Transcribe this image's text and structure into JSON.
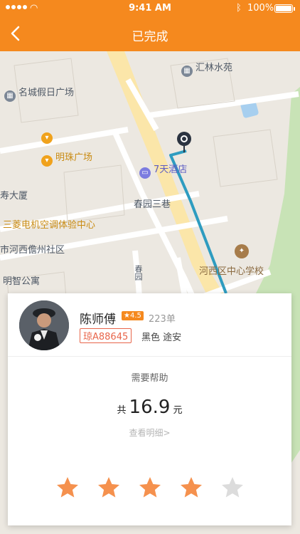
{
  "status_bar": {
    "time": "9:41 AM",
    "battery": "100%"
  },
  "nav": {
    "title": "已完成",
    "back_icon": "chevron-left-icon"
  },
  "map": {
    "pois": [
      {
        "label": "汇林水苑",
        "style": "gray",
        "icon": "building-icon"
      },
      {
        "label": "名城假日广场",
        "style": "gray",
        "icon": "building-icon"
      },
      {
        "label": "明珠广场",
        "style": "orange",
        "icon": "shopping-cart-icon"
      },
      {
        "label": "7天酒店",
        "style": "purple",
        "icon": "bed-icon"
      },
      {
        "label": "寿大厦",
        "style": "gray",
        "icon": ""
      },
      {
        "label": "春园三巷",
        "style": "gray",
        "icon": ""
      },
      {
        "label": "三菱电机空调体验中心",
        "style": "orange",
        "icon": ""
      },
      {
        "label": "市河西儋州社区",
        "style": "gray",
        "icon": ""
      },
      {
        "label": "河西区中心学校",
        "style": "brown",
        "icon": "school-icon"
      },
      {
        "label": "明智公寓",
        "style": "gray",
        "icon": ""
      },
      {
        "label": "春园",
        "style": "gray",
        "icon": ""
      }
    ]
  },
  "driver": {
    "name": "陈师傅",
    "rating": "★4.5",
    "orders": "223单",
    "plate": "琼A88645",
    "car": "黑色 途安"
  },
  "trip": {
    "help": "需要帮助",
    "total_prefix": "共",
    "amount": "16.9",
    "unit": "元",
    "detail_link": "查看明细>"
  },
  "rating_stars": {
    "filled": 4,
    "total": 5,
    "filled_color": "#f5914e",
    "empty_color": "#dcdcdc"
  }
}
